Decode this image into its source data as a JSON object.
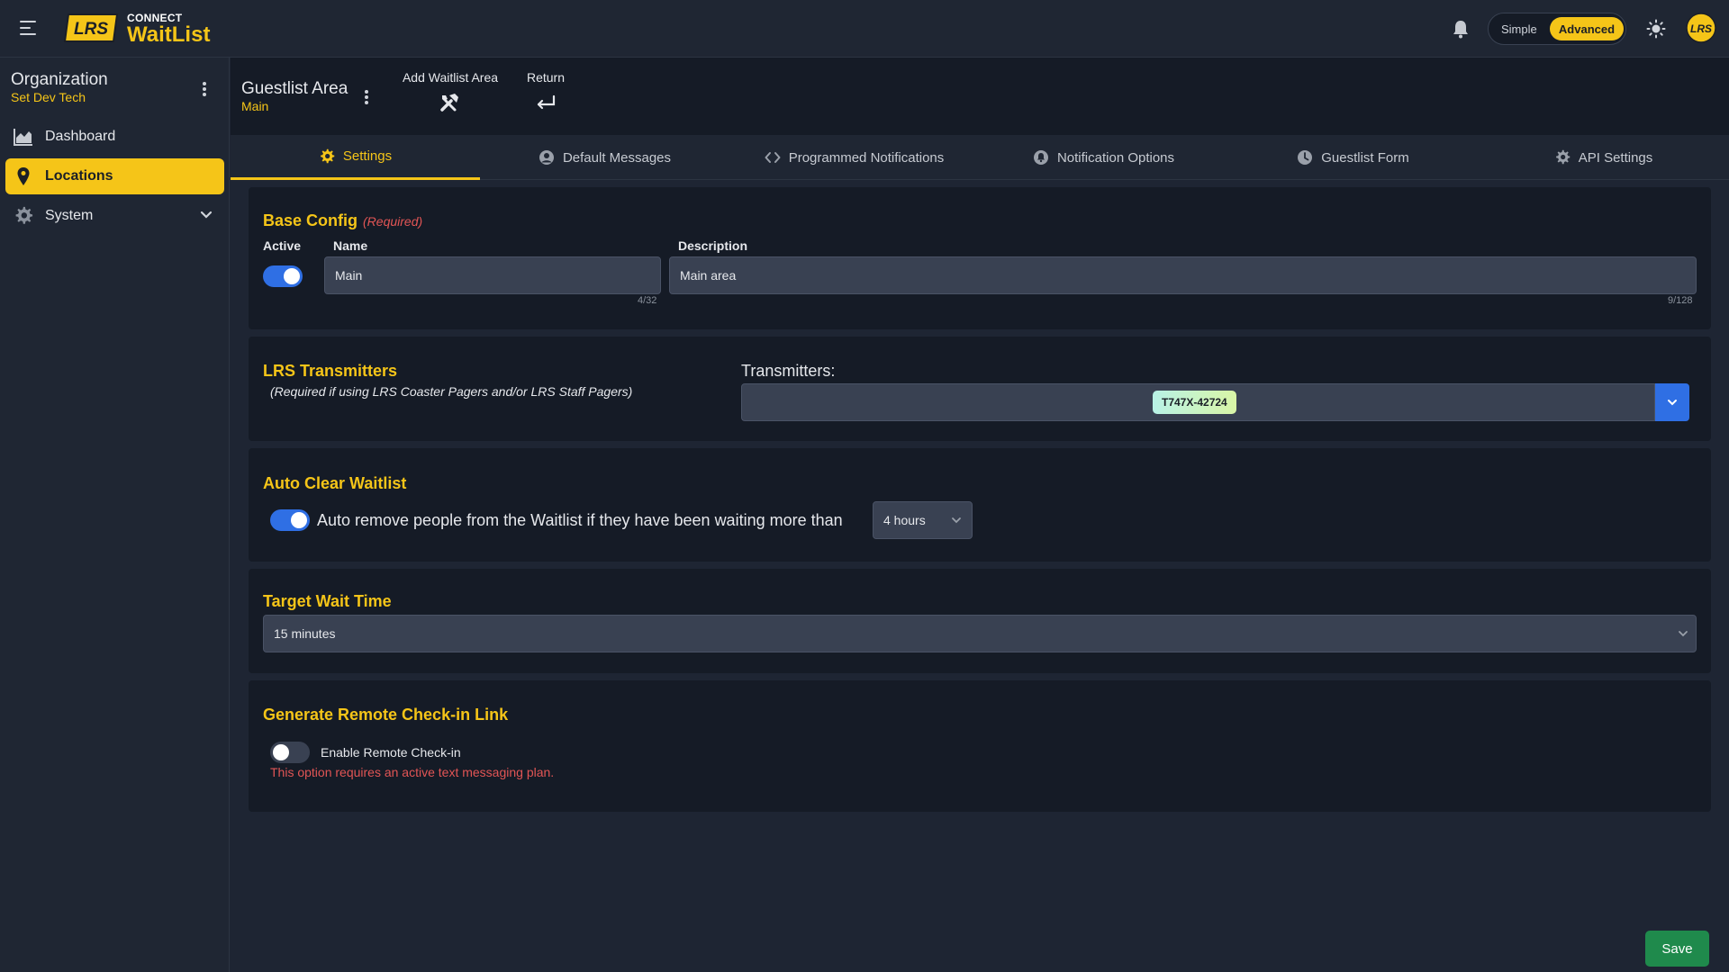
{
  "topbar": {
    "brand_small": "CONNECT",
    "brand_name": "WaitList",
    "logo_text": "LRS",
    "mode_simple": "Simple",
    "mode_advanced": "Advanced",
    "active_mode": "Advanced",
    "avatar_text": "LRS"
  },
  "sidebar": {
    "org_title": "Organization",
    "org_name": "Set Dev Tech",
    "items": [
      {
        "label": "Dashboard",
        "icon": "chart-area-icon",
        "active": false
      },
      {
        "label": "Locations",
        "icon": "map-pin-icon",
        "active": true
      },
      {
        "label": "System",
        "icon": "gear-icon",
        "active": false,
        "expandable": true
      }
    ]
  },
  "header": {
    "title": "Guestlist Area",
    "subtitle": "Main",
    "actions": [
      {
        "label": "Add Waitlist Area",
        "icon": "tools-icon"
      },
      {
        "label": "Return",
        "icon": "return-arrow-icon"
      }
    ]
  },
  "tabs": [
    {
      "label": "Settings",
      "icon": "gear-icon",
      "active": true
    },
    {
      "label": "Default Messages",
      "icon": "user-circle-icon",
      "active": false
    },
    {
      "label": "Programmed Notifications",
      "icon": "code-icon",
      "active": false
    },
    {
      "label": "Notification Options",
      "icon": "bell-circle-icon",
      "active": false
    },
    {
      "label": "Guestlist Form",
      "icon": "clock-icon",
      "active": false
    },
    {
      "label": "API Settings",
      "icon": "gear-icon",
      "active": false
    }
  ],
  "base_config": {
    "title": "Base Config",
    "required": "(Required)",
    "active_label": "Active",
    "active": true,
    "name_label": "Name",
    "name_value": "Main",
    "name_counter": "4/32",
    "description_label": "Description",
    "description_value": "Main area",
    "description_counter": "9/128"
  },
  "transmitters": {
    "title": "LRS Transmitters",
    "note": "(Required if using LRS Coaster Pagers and/or LRS Staff Pagers)",
    "label": "Transmitters:",
    "selected": [
      "T747X-42724"
    ]
  },
  "auto_clear": {
    "title": "Auto Clear Waitlist",
    "enabled": true,
    "text": "Auto remove people from the Waitlist if they have been waiting more than",
    "duration": "4 hours"
  },
  "target_wait": {
    "title": "Target Wait Time",
    "value": "15 minutes"
  },
  "remote_checkin": {
    "title": "Generate Remote Check-in Link",
    "enabled": false,
    "label": "Enable Remote Check-in",
    "warning": "This option requires an active text messaging plan."
  },
  "footer": {
    "save_label": "Save"
  },
  "colors": {
    "accent": "#f5c518",
    "toggle_on": "#2f6fe4",
    "save": "#1f8a4c",
    "error": "#e25555"
  }
}
